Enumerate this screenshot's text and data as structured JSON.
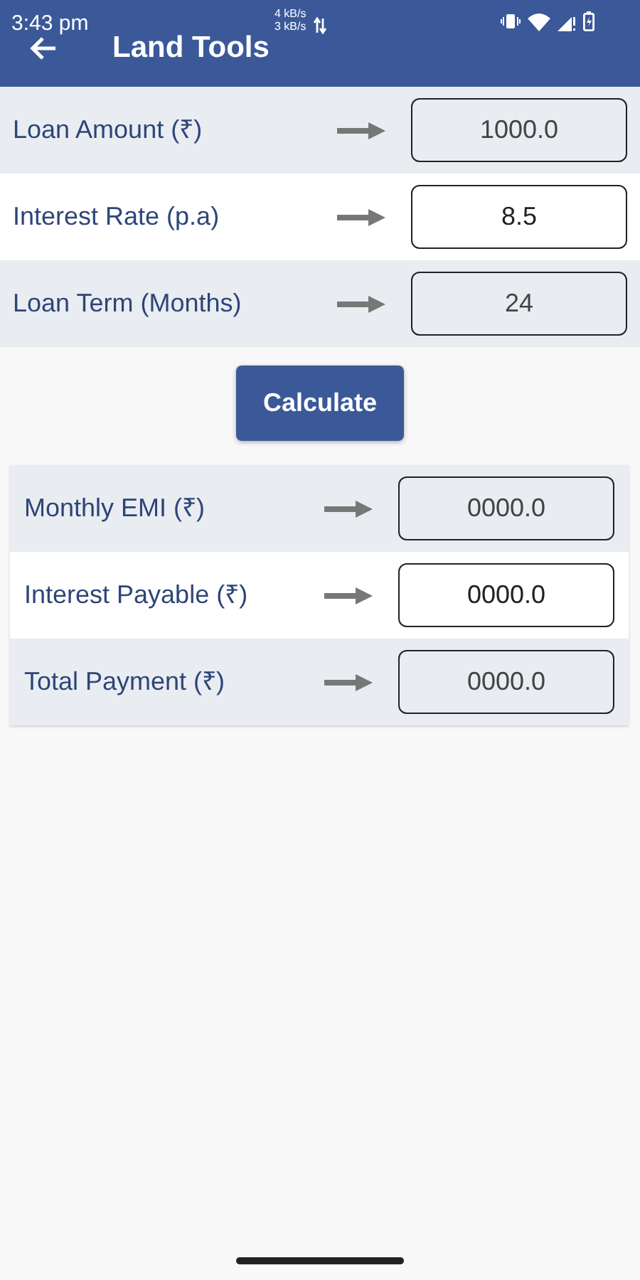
{
  "status_bar": {
    "time": "3:43 pm",
    "net_speed_up": "4 kB/s",
    "net_speed_down": "3 kB/s"
  },
  "app_bar": {
    "title": "Land Tools"
  },
  "inputs": [
    {
      "label": "Loan Amount (₹)",
      "value": "1000.0"
    },
    {
      "label": "Interest Rate (p.a)",
      "value": "8.5"
    },
    {
      "label": "Loan Term (Months)",
      "value": "24"
    }
  ],
  "calculate_button": "Calculate",
  "results": [
    {
      "label": "Monthly EMI (₹)",
      "value": "0000.0"
    },
    {
      "label": "Interest Payable (₹)",
      "value": "0000.0"
    },
    {
      "label": "Total Payment (₹)",
      "value": "0000.0"
    }
  ]
}
